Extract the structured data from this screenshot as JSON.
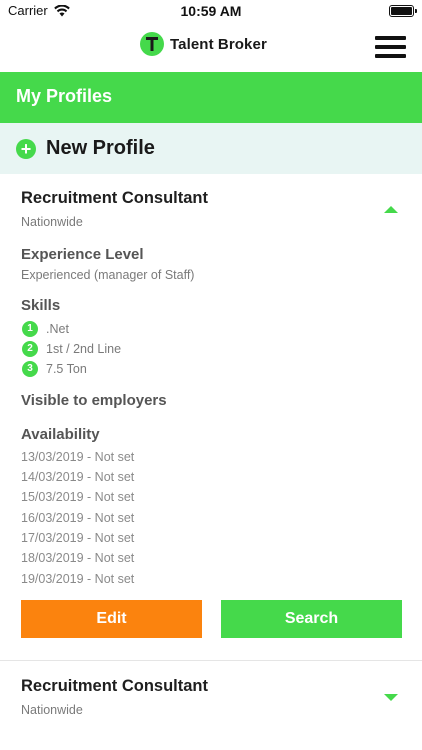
{
  "status_bar": {
    "carrier": "Carrier",
    "time": "10:59 AM"
  },
  "header": {
    "app_name": "Talent Broker",
    "brand_color": "#45d94b"
  },
  "section": {
    "title": "My Profiles"
  },
  "new_profile": {
    "label": "New Profile"
  },
  "profiles": [
    {
      "title": "Recruitment Consultant",
      "location": "Nationwide",
      "expanded": true,
      "experience_heading": "Experience Level",
      "experience_value": "Experienced (manager of Staff)",
      "skills_heading": "Skills",
      "skills": [
        {
          "num": "1",
          "label": ".Net"
        },
        {
          "num": "2",
          "label": "1st / 2nd Line"
        },
        {
          "num": "3",
          "label": "7.5 Ton"
        }
      ],
      "visibility": "Visible to employers",
      "availability_heading": "Availability",
      "availability": [
        "13/03/2019 - Not set",
        "14/03/2019 - Not set",
        "15/03/2019 - Not set",
        "16/03/2019 - Not set",
        "17/03/2019 - Not set",
        "18/03/2019 - Not set",
        "19/03/2019 - Not set"
      ],
      "edit_label": "Edit",
      "search_label": "Search"
    },
    {
      "title": "Recruitment Consultant",
      "location": "Nationwide",
      "expanded": false
    }
  ],
  "colors": {
    "green": "#45d94b",
    "orange": "#fb830e",
    "new_profile_bg": "#e8f5f3"
  },
  "icons": {
    "wifi": "wifi-icon",
    "battery": "battery-icon",
    "menu": "hamburger-menu-icon",
    "plus": "plus-circle-icon",
    "expand": "chevron-up-icon",
    "collapse": "chevron-down-icon"
  }
}
